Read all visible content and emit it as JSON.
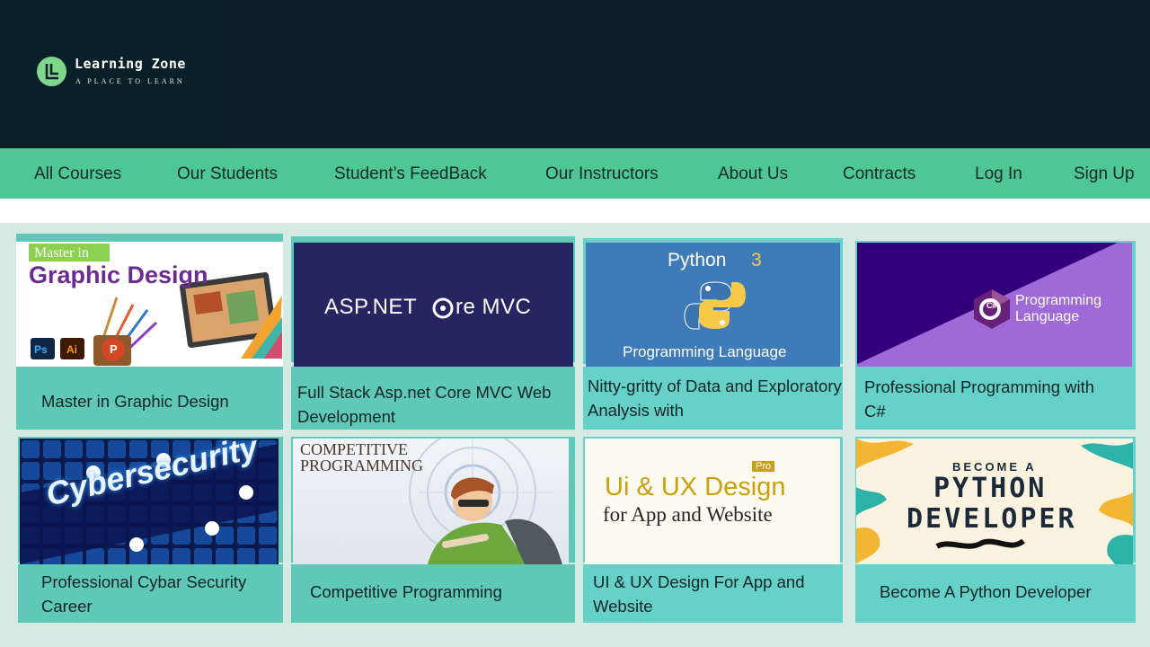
{
  "brand": {
    "name": "Learning Zone",
    "tagline": "A PLACE TO LEARN",
    "logo_icon": "learning-zone-logo"
  },
  "nav": [
    "All Courses",
    "Our Students",
    "Student’s FeedBack",
    "Our Instructors",
    "About Us",
    "Contracts",
    "Log In",
    "Sign Up"
  ],
  "courses": [
    {
      "title": "Master in Graphic Design",
      "image": {
        "banner": "Master in",
        "heading": "Graphic Design",
        "app_icons": [
          "Ps",
          "Ai",
          "P"
        ]
      }
    },
    {
      "title": "Full Stack Asp.net Core MVC Web Development",
      "image": {
        "text_left": "ASP.NET",
        "text_right": "re MVC"
      }
    },
    {
      "title": "Nitty-gritty of Data and Exploratory Analysis with",
      "image": {
        "heading": "Python",
        "version": "3",
        "subtitle": "Programming Language"
      }
    },
    {
      "title": "Professional Programming with C#",
      "image": {
        "badge": "C#",
        "line1": "Programming",
        "line2": "Language"
      }
    },
    {
      "title": "Professional Cybar Security Career",
      "image": {
        "heading": "Cybersecurity"
      }
    },
    {
      "title": "Competitive Programming",
      "image": {
        "line1": "COMPETITIVE",
        "line2": "PROGRAMMING"
      }
    },
    {
      "title": "UI & UX Design For App and Website",
      "image": {
        "badge": "Pro",
        "heading": "Ui & UX Design",
        "subtitle": "for App and Website"
      }
    },
    {
      "title": "Become A Python Developer",
      "image": {
        "line1": "BECOME A",
        "line2": "PYTHON",
        "line3": "DEVELOPER"
      }
    }
  ],
  "colors": {
    "header_bg": "#0d1d28",
    "nav_bg": "#4ec795",
    "page_bg": "#d6eae4",
    "card_teal_a": "#5fc8b6",
    "card_teal_b": "#66d1c9"
  }
}
